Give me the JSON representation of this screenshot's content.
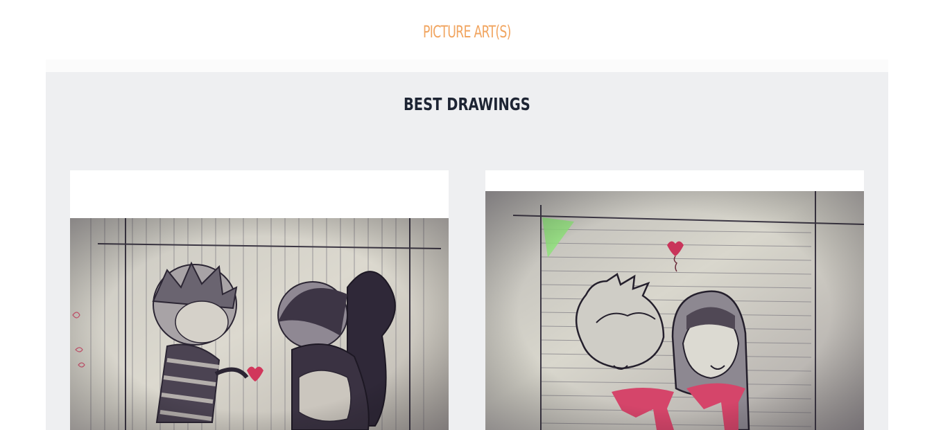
{
  "site": {
    "title": "PICTURE ART(S)"
  },
  "gallery": {
    "heading": "BEST DRAWINGS",
    "items": [
      {
        "image": "pencil-sketch-couple-on-lined-paper"
      },
      {
        "image": "pencil-sketch-couple-with-scarves-and-heart"
      }
    ]
  },
  "colors": {
    "title": "#f1a560",
    "heading": "#1d2433",
    "section_bg": "#eeeff1",
    "paper": "#d6d3c7",
    "heart": "#d1375b",
    "scarf": "#d5456a"
  }
}
